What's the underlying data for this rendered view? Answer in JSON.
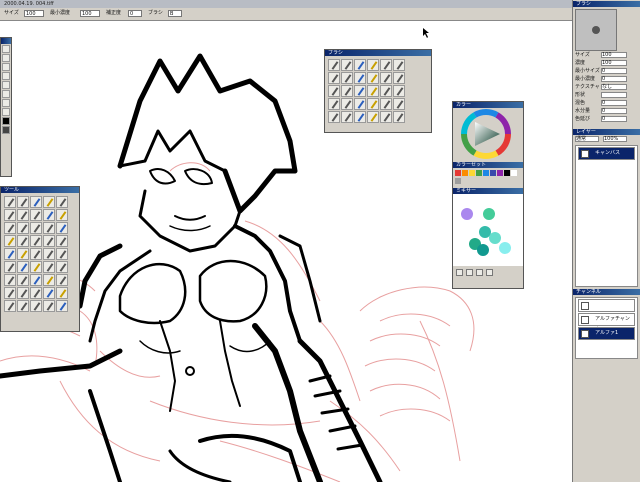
{
  "window": {
    "title": "2000.04.19. 004.tiff"
  },
  "toolbar": {
    "size_label": "サイズ",
    "size_value": "100",
    "density_label": "最小濃度",
    "density_value": "100",
    "min_label": "補正度",
    "min_value": "0",
    "option_label": "ブラシ",
    "option_value": "B"
  },
  "panels": {
    "brush_palette_title": "ブラシ",
    "color_wheel_title": "カラー",
    "color_set_title": "カラーセット",
    "mixer_title": "ミキサー",
    "layer_tool_title": "ツール"
  },
  "right_dock": {
    "brush_title": "ブラシ",
    "rows": [
      {
        "label": "サイズ",
        "value": "100"
      },
      {
        "label": "濃度",
        "value": "100"
      },
      {
        "label": "最小サイズ",
        "value": "0"
      },
      {
        "label": "最小濃度",
        "value": "0"
      },
      {
        "label": "テクスチャ",
        "value": "なし"
      },
      {
        "label": "形状",
        "value": ""
      },
      {
        "label": "混色",
        "value": "0"
      },
      {
        "label": "水分量",
        "value": "0"
      },
      {
        "label": "色延び",
        "value": "0"
      }
    ],
    "layer_title": "レイヤー",
    "layer_mode": "通常",
    "layer_opacity": "100%",
    "layers": [
      {
        "name": "キャンバス",
        "selected": true
      }
    ],
    "channel_title": "チャンネル",
    "channels": [
      {
        "name": "",
        "selected": false
      },
      {
        "name": "アルファチャンネル1",
        "selected": false
      },
      {
        "name": "アルファ1",
        "selected": true
      }
    ]
  },
  "colors": {
    "accent": "#0a246a",
    "sketch": "#e8a0a0",
    "swatch_colors": [
      "#e53935",
      "#fb8c00",
      "#fdd835",
      "#43a047",
      "#1e88e5",
      "#3949ab",
      "#8e24aa",
      "#000000",
      "#ffffff",
      "#9e9e9e"
    ],
    "mixer_dots": [
      "#aa88ee",
      "#44cc99",
      "#33bbaa",
      "#22aa88",
      "#66ddcc",
      "#11998f",
      "#88eeee"
    ]
  }
}
